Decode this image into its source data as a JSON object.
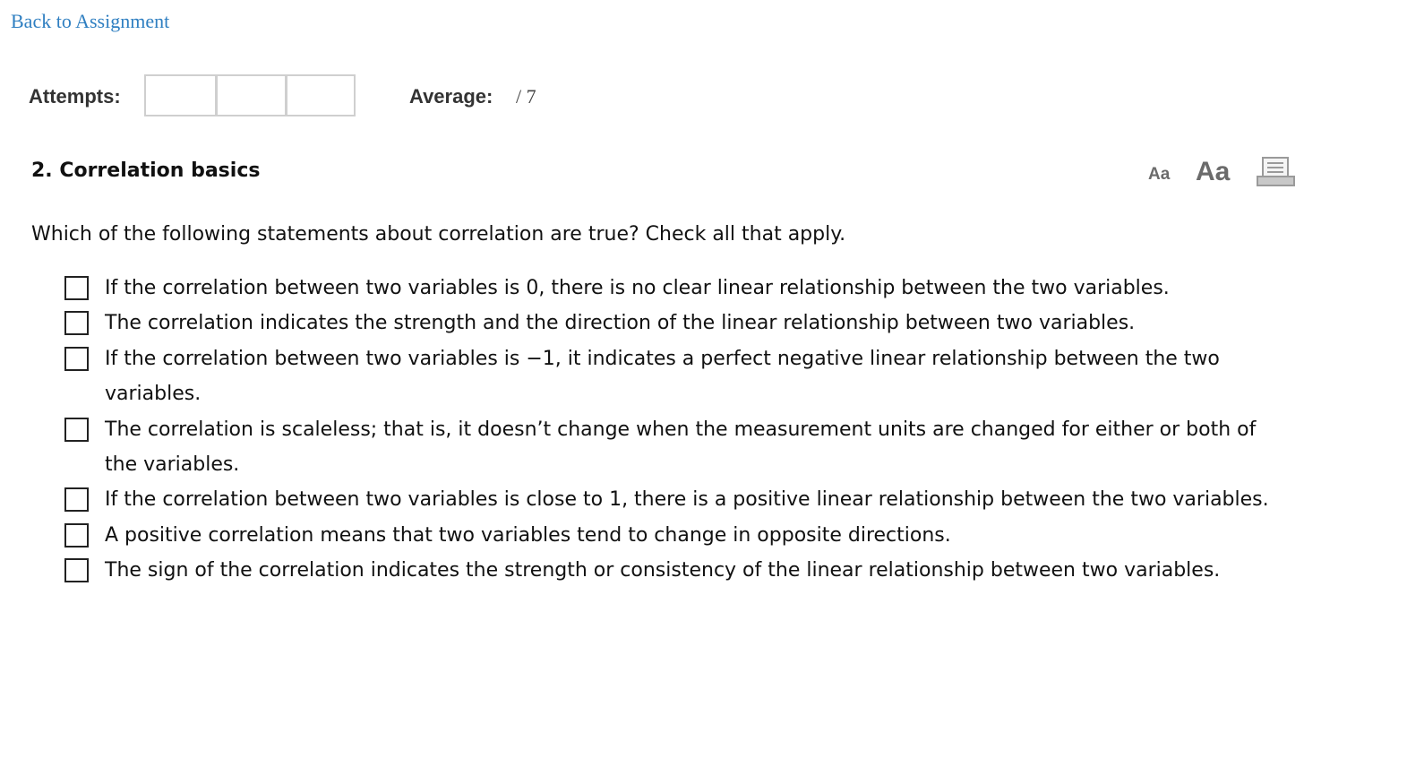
{
  "nav": {
    "back_label": "Back to Assignment"
  },
  "score": {
    "attempts_label": "Attempts:",
    "attempt_slots": [
      "",
      "",
      ""
    ],
    "average_label": "Average:",
    "average_value": "/ 7"
  },
  "question": {
    "title": "2.  Correlation basics",
    "prompt": "Which of the following statements about correlation are true? Check all that apply.",
    "options": [
      {
        "text": "If the correlation between two variables is 0, there is no clear linear relationship between the two variables.",
        "checked": false
      },
      {
        "text": "The correlation indicates the strength and the direction of the linear relationship between two variables.",
        "checked": false
      },
      {
        "text": "If the correlation between two variables is −1, it indicates a perfect negative linear relationship between the two variables.",
        "checked": false
      },
      {
        "text": "The correlation is scaleless; that is, it doesn’t change when the measurement units are changed for either or both of the variables.",
        "checked": false
      },
      {
        "text": "If the correlation between two variables is close to 1, there is a positive linear relationship between the two variables.",
        "checked": false
      },
      {
        "text": "A positive correlation means that two variables tend to change in opposite directions.",
        "checked": false
      },
      {
        "text": "The sign of the correlation indicates the strength or consistency of the linear relationship between two variables.",
        "checked": false
      }
    ]
  },
  "toolbar": {
    "font_small_label": "Aa",
    "font_large_label": "Aa",
    "print_icon": "printer-icon"
  },
  "colors": {
    "link": "#2f7fc1",
    "icon_gray": "#6b6b6b",
    "box_border": "#cfcfcf"
  }
}
